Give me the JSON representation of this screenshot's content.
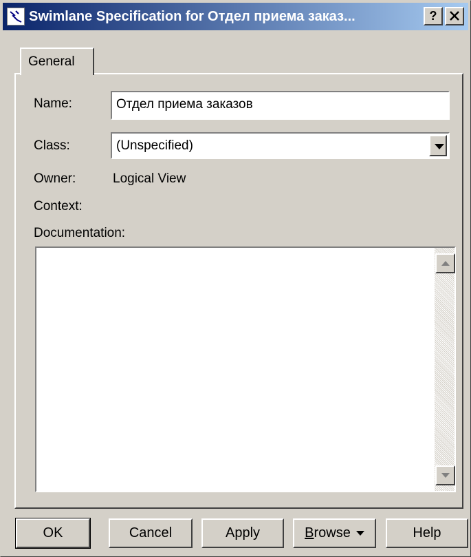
{
  "window": {
    "title": "Swimlane Specification for Отдел приема заказ...",
    "help_label": "?",
    "close_label": "✕"
  },
  "tabs": [
    {
      "label": "General"
    }
  ],
  "form": {
    "name_label": "Name:",
    "name_value": "Отдел приема заказов",
    "class_label": "Class:",
    "class_value": "(Unspecified)",
    "owner_label": "Owner:",
    "owner_value": "Logical View",
    "context_label": "Context:",
    "documentation_label": "Documentation:",
    "documentation_value": ""
  },
  "buttons": {
    "ok": "OK",
    "cancel": "Cancel",
    "apply": "Apply",
    "browse_first": "B",
    "browse_rest": "rowse",
    "help": "Help"
  },
  "colors": {
    "face": "#d4d0c8",
    "title_start": "#0a246a",
    "title_end": "#a6caf0"
  }
}
